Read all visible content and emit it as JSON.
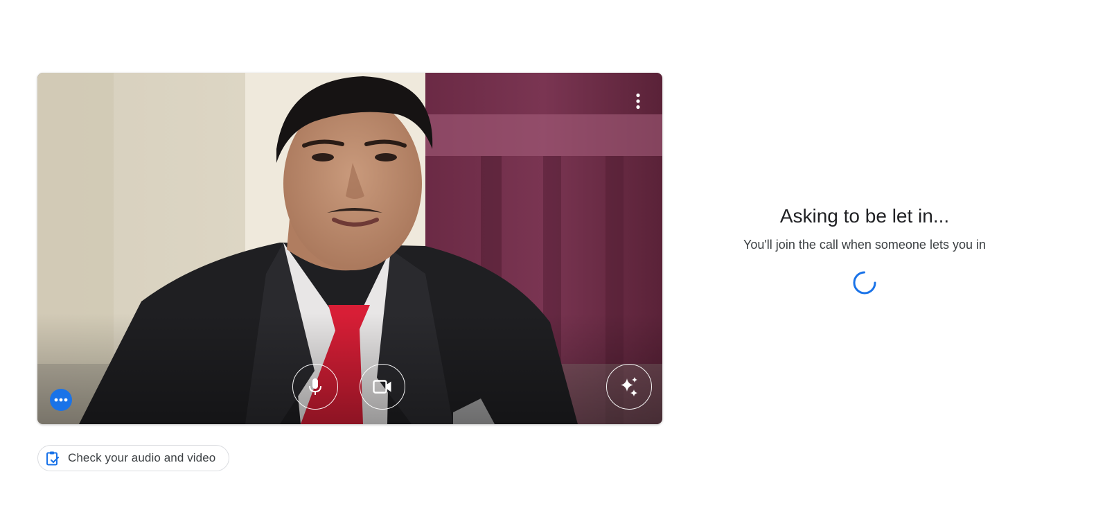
{
  "preview": {
    "more_options_icon": "more-vert-icon",
    "mic_icon": "microphone-icon",
    "camera_icon": "videocam-icon",
    "effects_icon": "sparkle-effects-icon",
    "self_view_icon": "more-horiz-icon",
    "accent_color": "#1a73e8"
  },
  "check_av": {
    "label": "Check your audio and video",
    "icon": "clipboard-check-icon"
  },
  "status": {
    "title": "Asking to be let in...",
    "subtitle": "You'll join the call when someone lets you in",
    "spinner_color": "#1a73e8"
  }
}
